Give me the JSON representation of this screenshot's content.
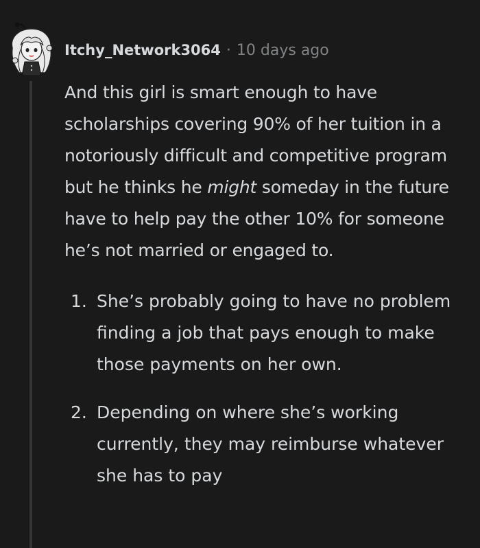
{
  "comment": {
    "author": "Itchy_Network3064",
    "separator": "·",
    "timestamp": "10 days ago",
    "body": {
      "p1_before": "And this girl is smart enough to have scholarships covering 90% of her tuition in a notoriously difficult and competitive program but he thinks he ",
      "p1_emphasis": "might",
      "p1_after": " someday in the future have to help pay the other 10% for someone he’s not married or engaged to.",
      "list": [
        {
          "number": "1.",
          "text": "She’s probably going to have no problem finding a job that pays enough to make those payments on her own."
        },
        {
          "number": "2.",
          "text": "Depending on where she’s working currently, they may reimburse whatever she has to pay"
        }
      ]
    }
  },
  "colors": {
    "background": "#1a1a1b",
    "text": "#d7dadc",
    "muted": "#818384",
    "thread_line": "#343536"
  }
}
